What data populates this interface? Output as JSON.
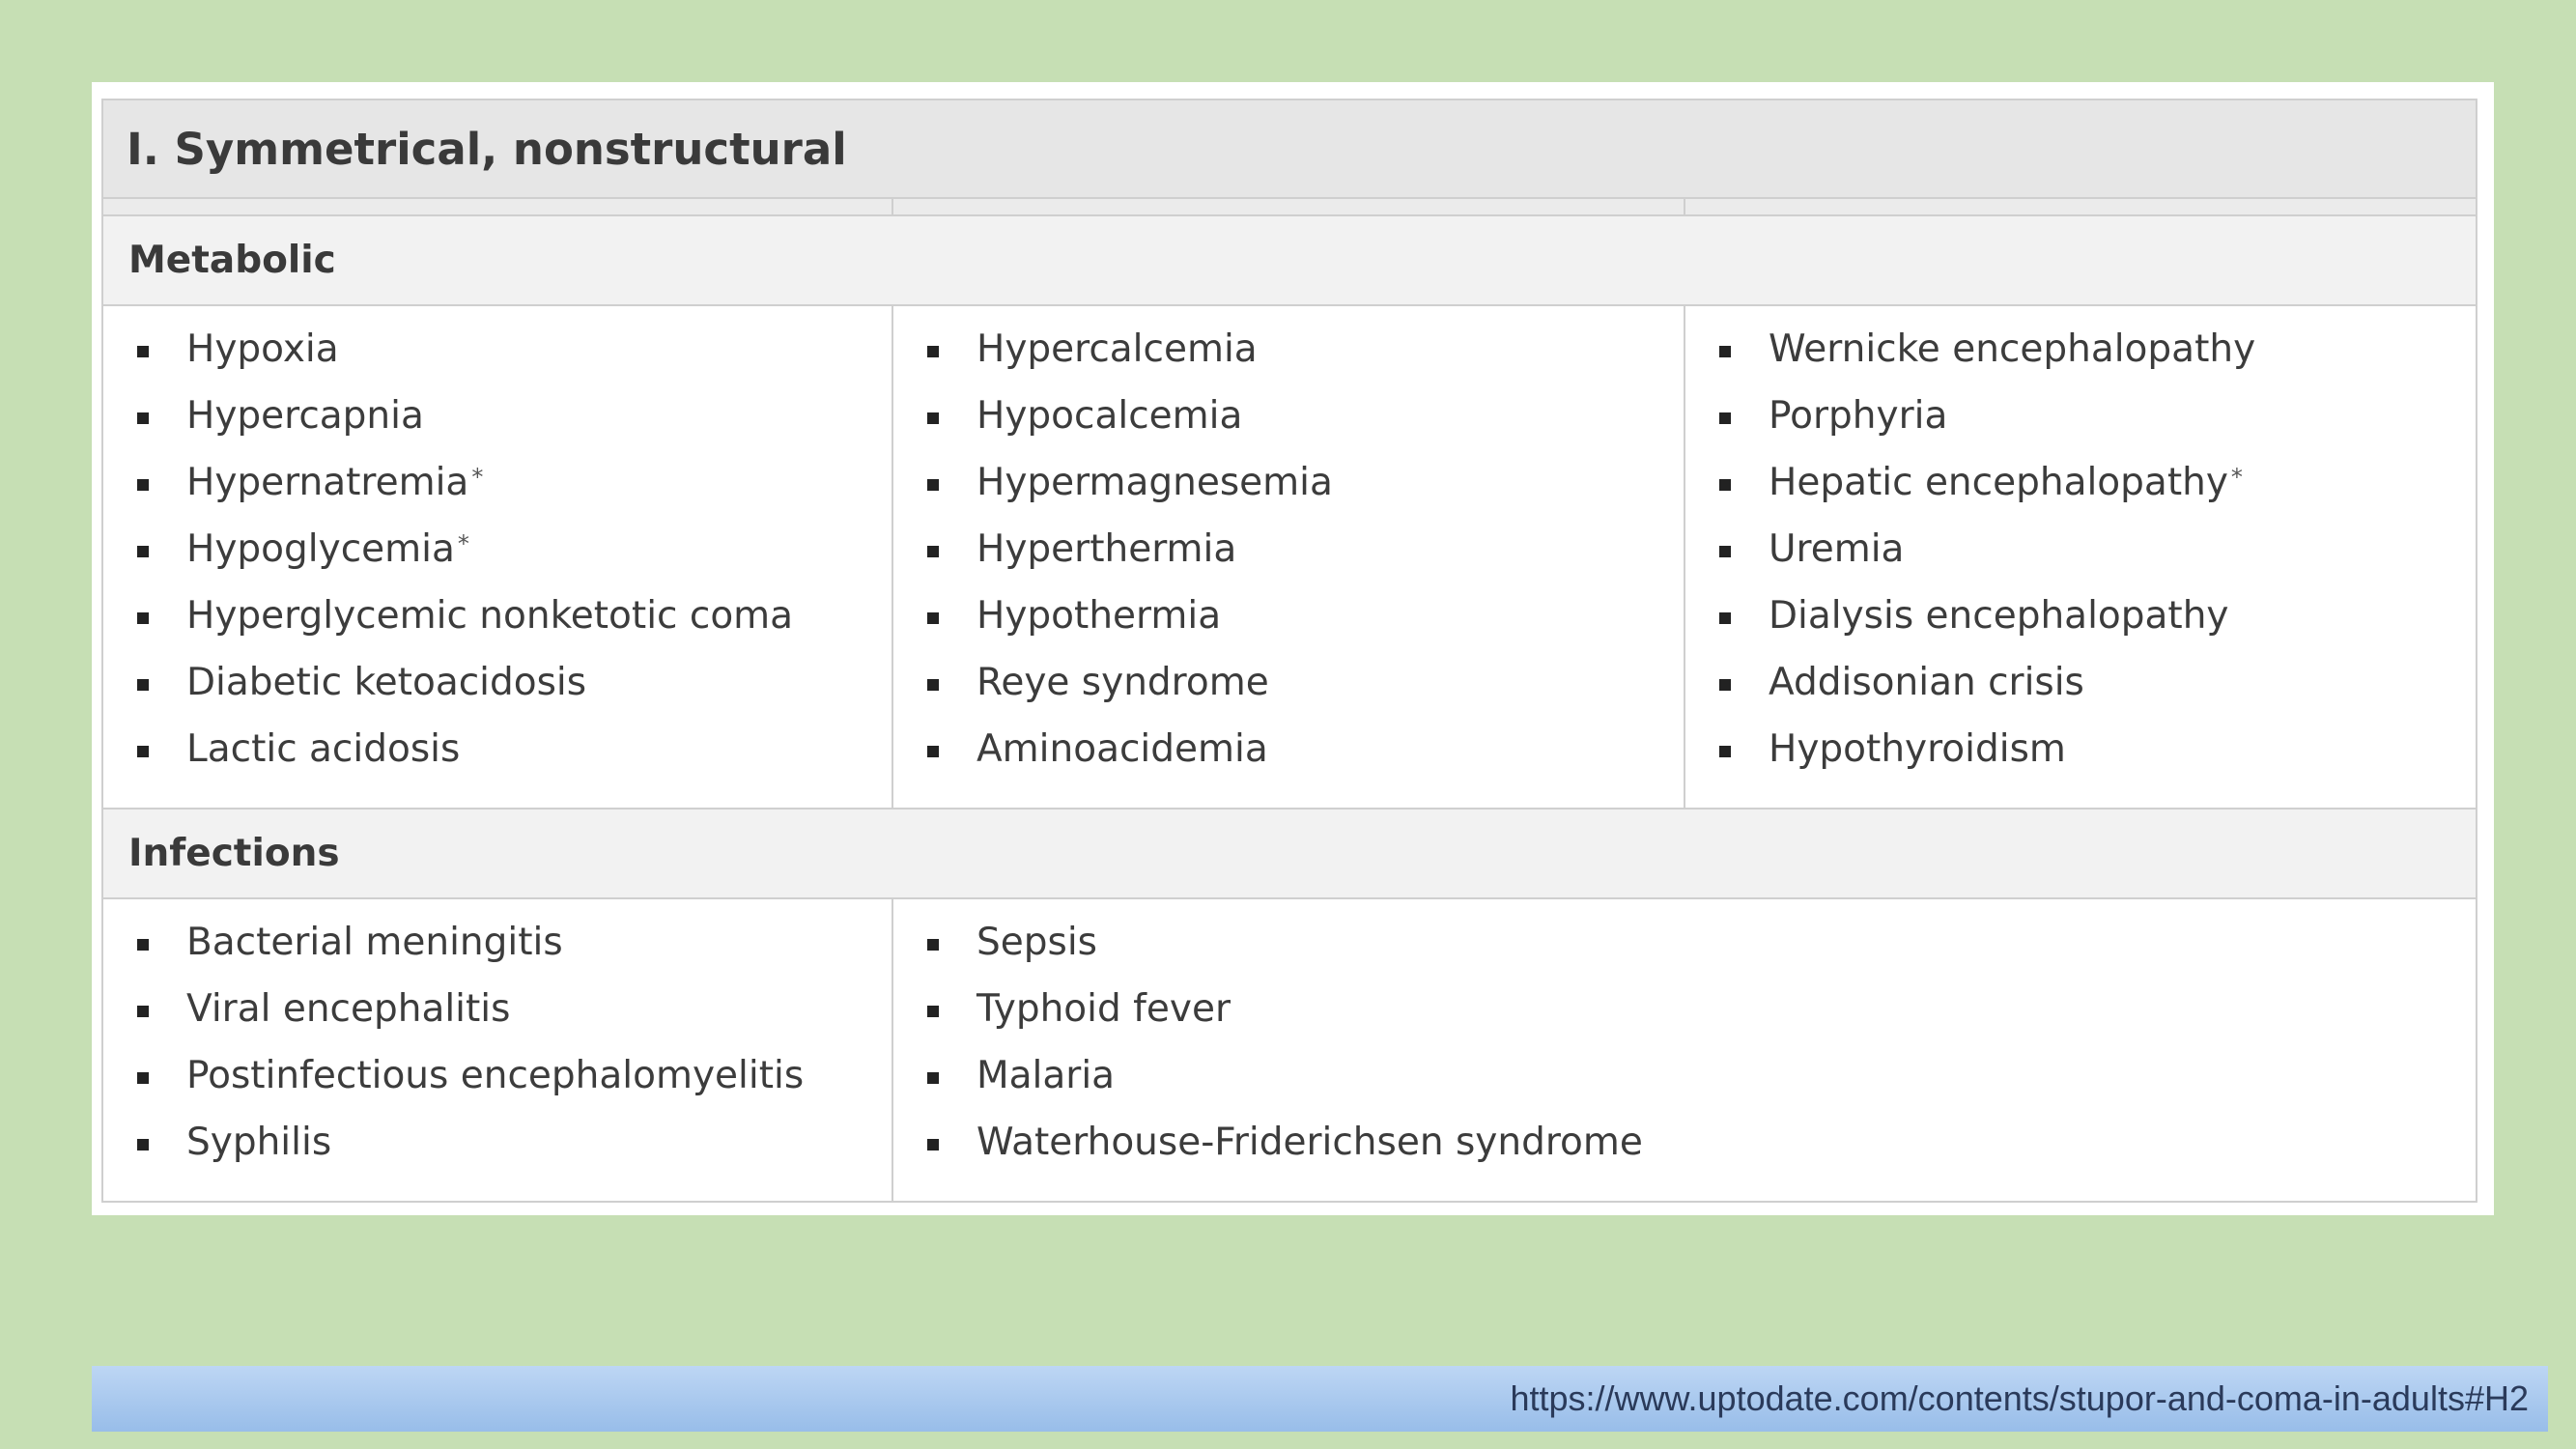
{
  "table": {
    "title": "I. Symmetrical, nonstructural",
    "sections": {
      "metabolic": {
        "heading": "Metabolic",
        "col1": [
          "Hypoxia",
          "Hypercapnia",
          "Hypernatremia",
          "Hypoglycemia",
          "Hyperglycemic nonketotic coma",
          "Diabetic ketoacidosis",
          "Lactic acidosis"
        ],
        "col2": [
          "Hypercalcemia",
          "Hypocalcemia",
          "Hypermagnesemia",
          "Hyperthermia",
          "Hypothermia",
          "Reye syndrome",
          "Aminoacidemia"
        ],
        "col3": [
          "Wernicke encephalopathy",
          "Porphyria",
          "Hepatic encephalopathy",
          "Uremia",
          "Dialysis encephalopathy",
          "Addisonian crisis",
          "Hypothyroidism"
        ]
      },
      "infections": {
        "heading": "Infections",
        "col1": [
          "Bacterial meningitis",
          "Viral encephalitis",
          "Postinfectious encephalomyelitis",
          "Syphilis"
        ],
        "col2": [
          "Sepsis",
          "Typhoid fever",
          "Malaria",
          "Waterhouse-Friderichsen syndrome"
        ]
      }
    },
    "footnote_mark": "*"
  },
  "footer": {
    "url": "https://www.uptodate.com/contents/stupor-and-coma-in-adults#H2"
  }
}
